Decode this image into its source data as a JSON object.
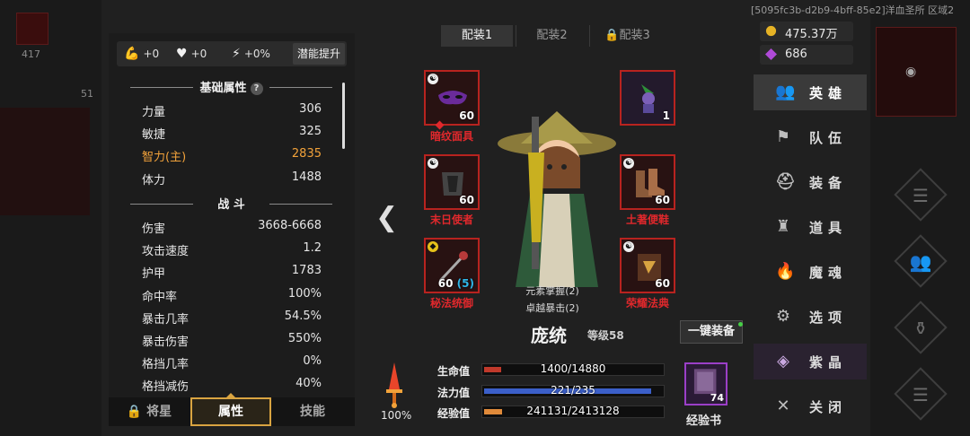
{
  "background": {
    "left_number_top": "417",
    "left_number_mid": "51"
  },
  "stat_bar": {
    "strength_bonus": "+0",
    "hp_bonus": "+0",
    "speed_bonus": "+0%",
    "potential_button": "潜能提升"
  },
  "basic_section": {
    "title": "基础属性",
    "help": "?",
    "rows": [
      {
        "label": "力量",
        "value": "306"
      },
      {
        "label": "敏捷",
        "value": "325"
      },
      {
        "label": "智力(主)",
        "value": "2835"
      },
      {
        "label": "体力",
        "value": "1488"
      }
    ]
  },
  "combat_section": {
    "title": "战 斗",
    "rows": [
      {
        "label": "伤害",
        "value": "3668-6668"
      },
      {
        "label": "攻击速度",
        "value": "1.2"
      },
      {
        "label": "护甲",
        "value": "1783"
      },
      {
        "label": "命中率",
        "value": "100%"
      },
      {
        "label": "暴击几率",
        "value": "54.5%"
      },
      {
        "label": "暴击伤害",
        "value": "550%"
      },
      {
        "label": "格挡几率",
        "value": "0%"
      },
      {
        "label": "格挡减伤",
        "value": "40%"
      }
    ]
  },
  "bottom_tabs": {
    "stars": "将星",
    "attributes": "属性",
    "skills": "技能"
  },
  "loadouts": [
    "配装1",
    "配装2",
    "配装3"
  ],
  "equipment": {
    "mask": {
      "name": "暗纹面具",
      "level": "60"
    },
    "pet": {
      "level": "1"
    },
    "armor": {
      "name": "末日使者",
      "level": "60"
    },
    "boots": {
      "name": "土著便鞋",
      "level": "60"
    },
    "weapon": {
      "name": "秘法统御",
      "level": "60",
      "bonus": "(5)"
    },
    "book": {
      "name": "荣耀法典",
      "level": "60"
    }
  },
  "set_tags": [
    "元素掌握(2)",
    "卓越暴击(2)"
  ],
  "hero": {
    "name": "庞统",
    "level": "等级58"
  },
  "equip_all_button": "一键装备",
  "power_pct": "100%",
  "bars": {
    "hp": {
      "label": "生命值",
      "text": "1400/14880",
      "fraction": 0.094,
      "color": "#c0392b"
    },
    "mp": {
      "label": "法力值",
      "text": "221/235",
      "fraction": 0.94,
      "color": "#3b5fc9"
    },
    "exp": {
      "label": "经验值",
      "text": "241131/2413128",
      "fraction": 0.1,
      "color": "#e08a3a"
    }
  },
  "exp_book": {
    "count": "74",
    "label": "经验书"
  },
  "server_info": "[5095fc3b-d2b9-4bff-85e2]洋血圣所 区域2",
  "currency": {
    "gold": "475.37万",
    "gems": "686"
  },
  "menu": [
    {
      "label": "英雄",
      "icon": "hero-icon"
    },
    {
      "label": "队伍",
      "icon": "flag-icon"
    },
    {
      "label": "装备",
      "icon": "helmet-icon"
    },
    {
      "label": "道具",
      "icon": "bag-icon"
    },
    {
      "label": "魔魂",
      "icon": "flame-icon"
    },
    {
      "label": "选项",
      "icon": "gear-icon"
    },
    {
      "label": "紫晶",
      "icon": "crystal-icon"
    },
    {
      "label": "关闭",
      "icon": "close-icon"
    }
  ]
}
